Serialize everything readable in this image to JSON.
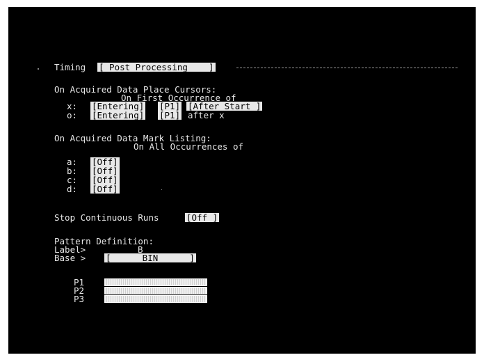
{
  "timing": {
    "label": "Timing",
    "mode": "[ Post Processing    ]"
  },
  "place_cursors": {
    "heading": "On Acquired Data Place Cursors:",
    "subheading": "On First Occurrence of",
    "x": {
      "label": "x:",
      "qualifier": "[Entering]",
      "pattern": "[P1]",
      "when": "[After Start ]"
    },
    "o": {
      "label": "o:",
      "qualifier": "[Entering]",
      "pattern": "[P1]",
      "when": "after x"
    }
  },
  "mark_listing": {
    "heading": "On Acquired Data Mark Listing:",
    "subheading": "On All Occurrences of",
    "rows": [
      {
        "label": "a:",
        "value": "[Off]"
      },
      {
        "label": "b:",
        "value": "[Off]"
      },
      {
        "label": "c:",
        "value": "[Off]"
      },
      {
        "label": "d:",
        "value": "[Off]"
      }
    ]
  },
  "stop_continuous": {
    "label": "Stop Continuous Runs",
    "value": "[Off ]"
  },
  "pattern_definition": {
    "heading": "Pattern Definition:",
    "label_prompt": "Label>",
    "label_value": "B",
    "base_prompt": "Base >",
    "base_value": "[      BIN      ]",
    "patterns": [
      {
        "name": "P1"
      },
      {
        "name": "P2"
      },
      {
        "name": "P3"
      }
    ]
  }
}
